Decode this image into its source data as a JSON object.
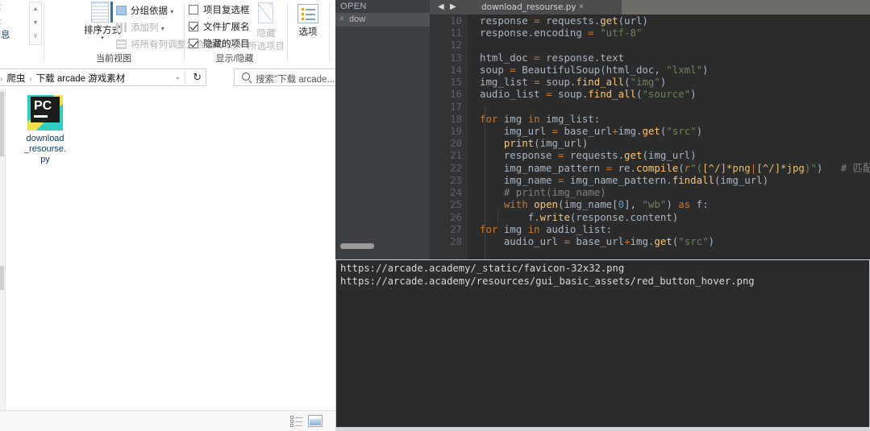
{
  "explorer": {
    "ribbon": {
      "group_panes": {
        "cut_labels": [
          "图标",
          "图标",
          "细信息"
        ],
        "spinner_icons": [
          "▲",
          "▼",
          "⊽"
        ]
      },
      "group_current_view": {
        "title": "当前视图",
        "sort_button": {
          "label": "排序方式",
          "icon": "sort-grid-icon",
          "caret": "▾"
        },
        "items": [
          {
            "label": "分组依据",
            "icon": "group-by-icon",
            "caret": "▾",
            "enabled": true
          },
          {
            "label": "添加列",
            "icon": "add-column-icon",
            "caret": "▾",
            "enabled": false
          },
          {
            "label": "将所有列调整为合适的大小",
            "icon": "autofit-columns-icon",
            "caret": "",
            "enabled": false
          }
        ]
      },
      "group_show_hide": {
        "title": "显示/隐藏",
        "checkboxes": [
          {
            "label": "项目复选框",
            "checked": false
          },
          {
            "label": "文件扩展名",
            "checked": true
          },
          {
            "label": "隐藏的项目",
            "checked": true
          }
        ],
        "hide_button": {
          "line1": "隐藏",
          "line2": "所选项目",
          "icon": "hide-selected-icon"
        },
        "options_button": {
          "label": "选项",
          "icon": "options-icon"
        }
      }
    },
    "address_bar": {
      "breadcrumbs": [
        "爬虫",
        "下载 arcade 游戏素材"
      ],
      "leading_sep": "›",
      "separator": "›",
      "dropdown_icon": "chevron-down-icon",
      "refresh_icon": "↻",
      "search": {
        "placeholder": "搜索\"下载 arcade...",
        "icon": "search-icon"
      }
    },
    "files": [
      {
        "name": "download_resourse.py",
        "name_lines": [
          "download",
          "_resourse.",
          "py"
        ],
        "icon": "pycharm-py-file-icon"
      }
    ],
    "status_bar": {
      "view_icons": [
        "list-view-icon",
        "thumbnail-view-icon"
      ]
    }
  },
  "ide": {
    "project_panel": {
      "header": "OPEN",
      "open_file": {
        "close_icon": "×",
        "name": "dow"
      }
    },
    "tab_bar": {
      "nav_prev_icon": "◀",
      "nav_next_icon": "▶",
      "tabs": [
        {
          "label": "download_resourse.py",
          "close_icon": "×",
          "active": true
        }
      ]
    },
    "editor": {
      "first_line_number": 10,
      "lines": [
        {
          "n": 10,
          "html": "<span class='id'>response </span><span class='op'>= </span><span class='id'>requests.</span><span class='mth'>get</span><span class='id'>(url)</span>"
        },
        {
          "n": 11,
          "html": "<span class='id'>response.encoding </span><span class='op'>= </span><span class='st'>\"utf-8\"</span>"
        },
        {
          "n": 12,
          "html": ""
        },
        {
          "n": 13,
          "html": "<span class='id'>html_doc </span><span class='op'>= </span><span class='id'>response.text</span>"
        },
        {
          "n": 14,
          "html": "<span class='id'>soup </span><span class='op'>= </span><span class='mth' style='color:#a9b7c6'>BeautifulSoup</span><span class='id'>(html_doc, </span><span class='st'>\"lxml\"</span><span class='id'>)</span>"
        },
        {
          "n": 15,
          "html": "<span class='id'>img_list </span><span class='op'>= </span><span class='id'>soup.</span><span class='mth'>find_all</span><span class='id'>(</span><span class='st'>\"img\"</span><span class='id'>)</span>"
        },
        {
          "n": 16,
          "html": "<span class='id'>audio_list </span><span class='op'>= </span><span class='id'>soup.</span><span class='mth'>find_all</span><span class='id'>(</span><span class='st'>\"source\"</span><span class='id'>)</span>"
        },
        {
          "n": 17,
          "html": ""
        },
        {
          "n": 18,
          "html": "<span class='kw'>for </span><span class='id'>img </span><span class='kw'>in </span><span class='id'>img_list:</span>"
        },
        {
          "n": 19,
          "html": "    <span class='id'>img_url </span><span class='op'>= </span><span class='id'>base_url</span><span class='op'>+</span><span class='id'>img.</span><span class='mth'>get</span><span class='id'>(</span><span class='st'>\"src\"</span><span class='id'>)</span>"
        },
        {
          "n": 20,
          "html": "    <span class='mth'>print</span><span class='id'>(img_url)</span>"
        },
        {
          "n": 21,
          "html": "    <span class='id'>response </span><span class='op'>= </span><span class='id'>requests.</span><span class='mth'>get</span><span class='id'>(img_url)</span>"
        },
        {
          "n": 22,
          "html": "    <span class='id'>img_name_pattern </span><span class='op'>= </span><span class='id'>re.</span><span class='mth'>compile</span><span class='id'>(</span><span class='rpfx'>r</span><span class='st'>\"(</span><span class='rx'>[^/]*png</span><span class='rxp'>|</span><span class='rx'>[^/]*jpg</span><span class='st'>)\"</span><span class='id'>)</span>   <span class='cm'># 匹配图片名称</span>"
        },
        {
          "n": 23,
          "html": "    <span class='id'>img_name </span><span class='op'>= </span><span class='id'>img_name_pattern.</span><span class='mth'>findall</span><span class='id'>(img_url)</span>"
        },
        {
          "n": 24,
          "html": "    <span class='cm'># print(img_name)</span>"
        },
        {
          "n": 25,
          "html": "    <span class='kw'>with </span><span class='mth'>open</span><span class='id'>(img_name[</span><span class='num2'>0</span><span class='id'>], </span><span class='st'>\"wb\"</span><span class='id'>) </span><span class='kw'>as </span><span class='id'>f:</span>"
        },
        {
          "n": 26,
          "html": "        <span class='id'>f.</span><span class='mth'>write</span><span class='id'>(response.content)</span>"
        },
        {
          "n": 27,
          "html": "<span class='kw'>for </span><span class='id'>img </span><span class='kw'>in </span><span class='id'>audio_list:</span>"
        },
        {
          "n": 28,
          "html": "    <span class='id'>audio_url </span><span class='op'>= </span><span class='id'>base_url</span><span class='op'>+</span><span class='id'>img.</span><span class='mth'>get</span><span class='id'>(</span><span class='st'>\"src\"</span><span class='id'>)</span>"
        }
      ]
    },
    "console": {
      "output_lines": [
        "https://arcade.academy/_static/favicon-32x32.png",
        "https://arcade.academy/resources/gui_basic_assets/red_button_hover.png"
      ]
    }
  },
  "colors": {
    "editor_bg": "#2b2b2b",
    "gutter_bg": "#313335",
    "panel_bg": "#3c3f41",
    "tabbar_bg": "#6e6e68",
    "keyword": "#cc7832",
    "string": "#6a8759",
    "function": "#ffc66d",
    "identifier": "#a9b7c6",
    "comment": "#808080",
    "number": "#6897bb",
    "explorer_link": "#0b3d6e"
  }
}
